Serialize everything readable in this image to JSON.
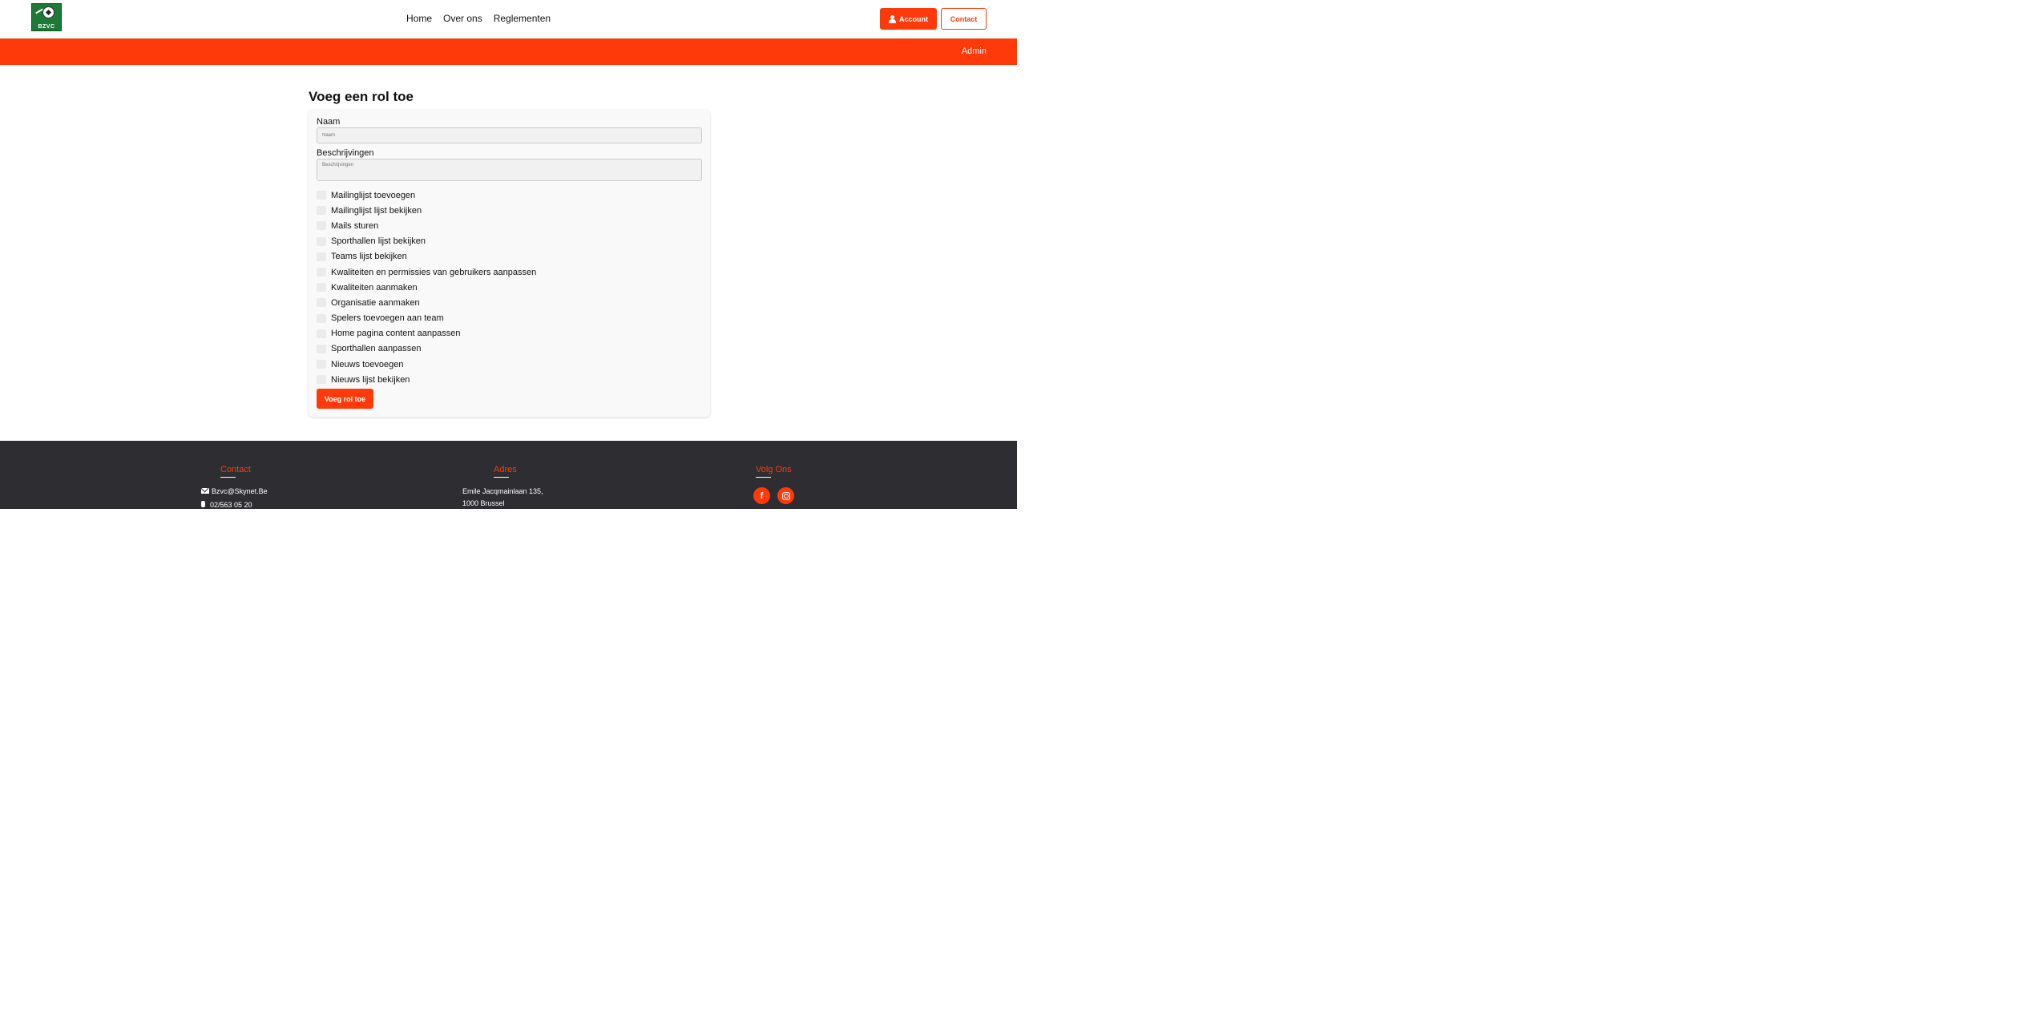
{
  "header": {
    "logo_text": "BZVC",
    "nav": [
      "Home",
      "Over ons",
      "Reglementen"
    ],
    "account_label": "Account",
    "contact_label": "Contact"
  },
  "admin_bar": {
    "label": "Admin"
  },
  "form": {
    "title": "Voeg een rol toe",
    "name_label": "Naam",
    "name_placeholder": "Naam",
    "desc_label": "Beschrijvingen",
    "desc_placeholder": "Beschrijvingen",
    "permissions": [
      "Mailinglijst toevoegen",
      "Mailinglijst lijst bekijken",
      "Mails sturen",
      "Sporthallen lijst bekijken",
      "Teams lijst bekijken",
      "Kwaliteiten en permissies van gebruikers aanpassen",
      "Kwaliteiten aanmaken",
      "Organisatie aanmaken",
      "Spelers toevoegen aan team",
      "Home pagina content aanpassen",
      "Sporthallen aanpassen",
      "Nieuws toevoegen",
      "Nieuws lijst bekijken"
    ],
    "submit_label": "Voeg rol toe"
  },
  "footer": {
    "contact_title": "Contact",
    "email": "Bzvc@Skynet.Be",
    "phone": "02/563 05 20",
    "address_title": "Adres",
    "address_line1": "Emile Jacqmainlaan 135,",
    "address_line2": "1000 Brussel",
    "social_title": "Volg Ons"
  },
  "colors": {
    "accent": "#ff3a0a",
    "footer_bg": "#2e2e32"
  }
}
